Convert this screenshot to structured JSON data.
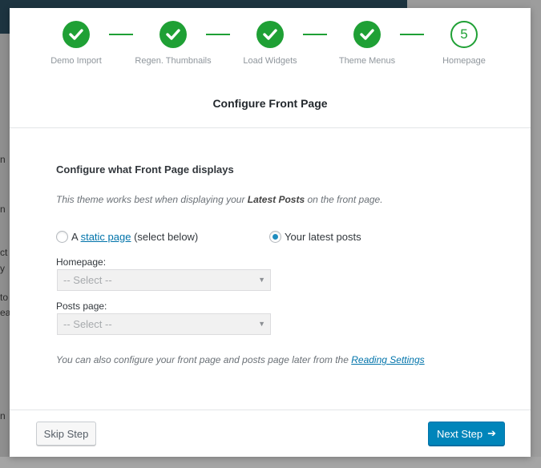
{
  "steps": [
    {
      "label": "Demo Import",
      "state": "done"
    },
    {
      "label": "Regen. Thumbnails",
      "state": "done"
    },
    {
      "label": "Load Widgets",
      "state": "done"
    },
    {
      "label": "Theme Menus",
      "state": "done"
    },
    {
      "label": "Homepage",
      "state": "current",
      "number": "5"
    }
  ],
  "title": "Configure Front Page",
  "section_heading": "Configure what Front Page displays",
  "intro": {
    "before": "This theme works best when displaying your ",
    "bold": "Latest Posts",
    "after": " on the front page."
  },
  "radio_static": {
    "prefix": "A ",
    "link": "static page",
    "suffix": " (select below)",
    "checked": false
  },
  "radio_latest": {
    "label": "Your latest posts",
    "checked": true
  },
  "homepage_field": {
    "label": "Homepage:",
    "value": "-- Select --"
  },
  "posts_field": {
    "label": "Posts page:",
    "value": "-- Select --"
  },
  "footer_note": {
    "text": "You can also configure your front page and posts page later from the ",
    "link": "Reading Settings"
  },
  "buttons": {
    "skip": "Skip Step",
    "next": "Next Step"
  },
  "colors": {
    "accent_green": "#1fa035",
    "primary_blue": "#0085ba",
    "link_blue": "#0073aa"
  },
  "background_fragments": [
    "n",
    "n",
    "ct",
    "y",
    "to",
    "ea",
    "n"
  ]
}
